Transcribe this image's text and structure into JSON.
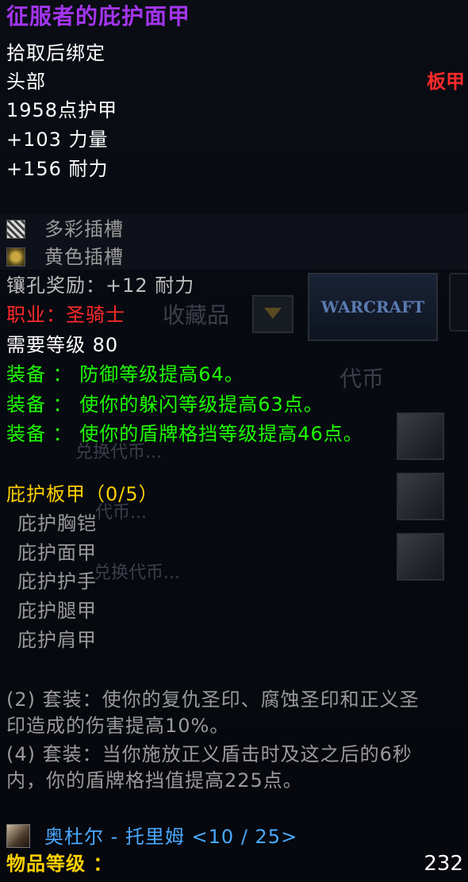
{
  "item": {
    "name": "征服者的庇护面甲",
    "binding": "拾取后绑定",
    "slot": "头部",
    "armor_type": "板甲",
    "armor": "1958点护甲",
    "stats": [
      "+103 力量",
      "+156 耐力"
    ],
    "sockets": [
      {
        "icon": "prismatic-socket-icon",
        "label": "多彩插槽"
      },
      {
        "icon": "yellow-socket-icon",
        "label": "黄色插槽"
      }
    ],
    "socket_bonus": "镶孔奖励：+12 耐力",
    "class_req": "职业：圣骑士",
    "level_req": "需要等级 80",
    "equip_effects": [
      "装备 ： 防御等级提高64。",
      "装备 ： 使你的躲闪等级提高63点。",
      "装备 ： 使你的盾牌格挡等级提高46点。"
    ],
    "set": {
      "name": "庇护板甲（0/5）",
      "pieces": [
        "庇护胸铠",
        "庇护面甲",
        "庇护护手",
        "庇护腿甲",
        "庇护肩甲"
      ],
      "bonuses": [
        {
          "line1": "(2) 套装：使你的复仇圣印、腐蚀圣印和正义圣",
          "line2": "印造成的伤害提高10%。"
        },
        {
          "line1": "(4) 套装：当你施放正义盾击时及这之后的6秒",
          "line2": "内，你的盾牌格挡值提高225点。"
        }
      ]
    },
    "source": "奥杜尔 - 托里姆 <10 / 25>",
    "item_level_label": "物品等级 ：",
    "item_level": "232"
  },
  "background": {
    "collection_label": "收藏品",
    "currency_label": "代币",
    "exchange_label1": "兑换代币...",
    "exchange_label2": "代币...",
    "exchange_label3": "兑换代币...",
    "logo_text": "WARCRAFT"
  },
  "colors": {
    "epic": "#a335ee",
    "red": "#ff2a2a",
    "green": "#1eff00",
    "gold": "#ffd100",
    "gray": "#9a9a9a",
    "blue": "#4aa8ff"
  }
}
